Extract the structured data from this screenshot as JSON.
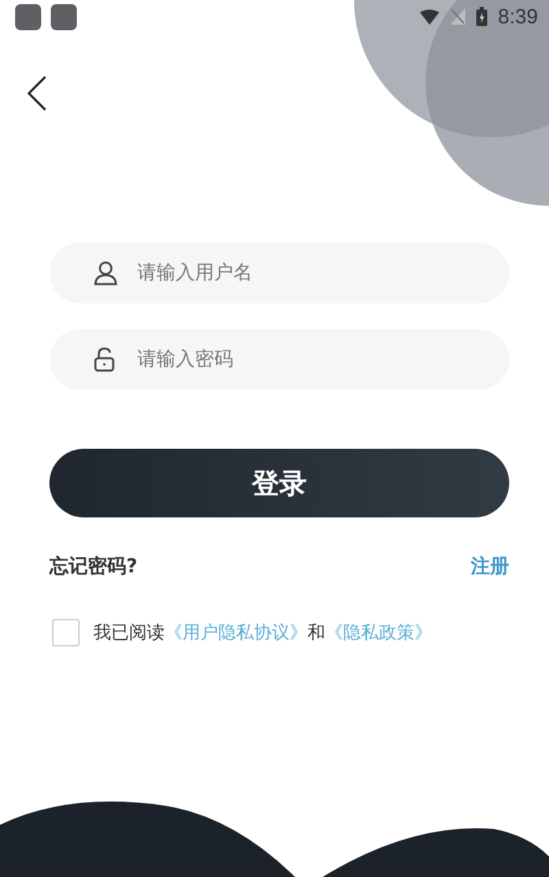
{
  "status_bar": {
    "time": "8:39"
  },
  "username": {
    "placeholder": "请输入用户名"
  },
  "password": {
    "placeholder": "请输入密码"
  },
  "login_button": {
    "label": "登录"
  },
  "forgot_password": "忘记密码?",
  "register": "注册",
  "agreement": {
    "checked": false,
    "text": "我已阅读",
    "links": [
      "《用户隐私协议》",
      "《隐私政策》"
    ],
    "joiner": "和"
  }
}
